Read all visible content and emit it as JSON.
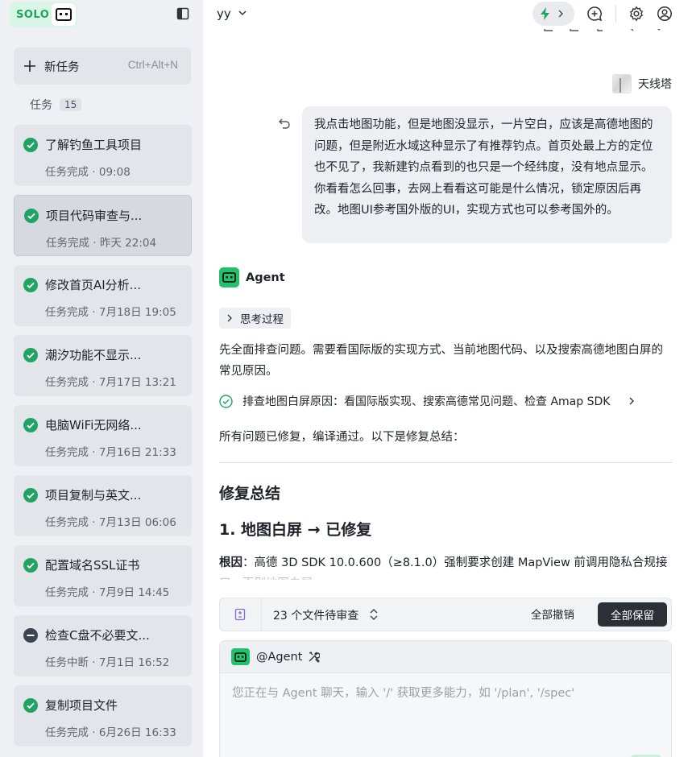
{
  "sidebar": {
    "logo_text": "SOLO",
    "new_task": {
      "label": "新任务",
      "shortcut": "Ctrl+Alt+N"
    },
    "tasks_header": {
      "title": "任务",
      "count": "15"
    },
    "tasks": [
      {
        "title": "了解钓鱼工具项目",
        "status": "任务完成 · 09:08",
        "state": "done"
      },
      {
        "title": "项目代码审查与...",
        "status": "任务完成 · 昨天 22:04",
        "state": "done"
      },
      {
        "title": "修改首页AI分析...",
        "status": "任务完成 · 7月18日 19:05",
        "state": "done"
      },
      {
        "title": "潮汐功能不显示...",
        "status": "任务完成 · 7月17日 13:21",
        "state": "done"
      },
      {
        "title": "电脑WiFi无网络...",
        "status": "任务完成 · 7月16日 21:33",
        "state": "done"
      },
      {
        "title": "项目复制与英文...",
        "status": "任务完成 · 7月13日 06:06",
        "state": "done"
      },
      {
        "title": "配置域名SSL证书",
        "status": "任务完成 · 7月9日 14:45",
        "state": "done"
      },
      {
        "title": "检查C盘不必要文...",
        "status": "任务中断 · 7月1日 16:52",
        "state": "interrupted"
      },
      {
        "title": "复制项目文件",
        "status": "任务完成 · 6月26日 16:33",
        "state": "done"
      }
    ]
  },
  "topbar": {
    "project_name": "yy"
  },
  "chat": {
    "user": {
      "name": "天线塔",
      "message": "我点击地图功能，但是地图没显示，一片空白，应该是高德地图的问题，但是附近水域这种显示了有推荐钓点。首页处最上方的定位也不见了，我新建钓点看到的也只是一个经纬度，没有地点显示。你看看怎么回事，去网上看看这可能是什么情况，锁定原因后再改。地图UI参考国外版的UI，实现方式也可以参考国外的。"
    },
    "agent": {
      "name": "Agent",
      "thinking_label": "思考过程",
      "text1": "先全面排查问题。需要看国际版的实现方式、当前地图代码、以及搜索高德地图白屏的常见原因。",
      "step_label": "排查地图白屏原因：看国际版实现、搜索高德常见问题、检查 Amap SDK",
      "text2": "所有问题已修复，编译通过。以下是修复总结：",
      "heading": "修复总结",
      "subheading": "1. 地图白屏 → 已修复",
      "cause_label": "根因",
      "cause_text": "：高德 3D SDK 10.0.600（≥8.1.0）强制要求创建 MapView 前调用隐私合规接口，否则地图白屏。"
    }
  },
  "review": {
    "label": "23 个文件待审查",
    "revoke": "全部撤销",
    "keep": "全部保留"
  },
  "composer": {
    "mention": "@Agent",
    "placeholder": "您正在与 Agent 聊天，输入 '/' 获取更多能力，如 '/plan', '/spec'"
  },
  "colors": {
    "accent": "#23c16b",
    "logo_bg": "#d9f5e6",
    "sidebar_bg": "#eef0f3",
    "keep_button": "#2b2f36"
  },
  "icons": {
    "collapse": "sidebar-toggle-icon",
    "new": "plus-icon",
    "done": "check-circle-icon",
    "interrupted": "minus-circle-icon",
    "mode": "lightning-icon",
    "chat": "chat-plus-icon",
    "settings": "gear-icon",
    "account": "user-circle-icon",
    "undo": "undo-icon",
    "doc": "document-icon",
    "sort": "sort-icon",
    "tools": "tools-icon"
  }
}
